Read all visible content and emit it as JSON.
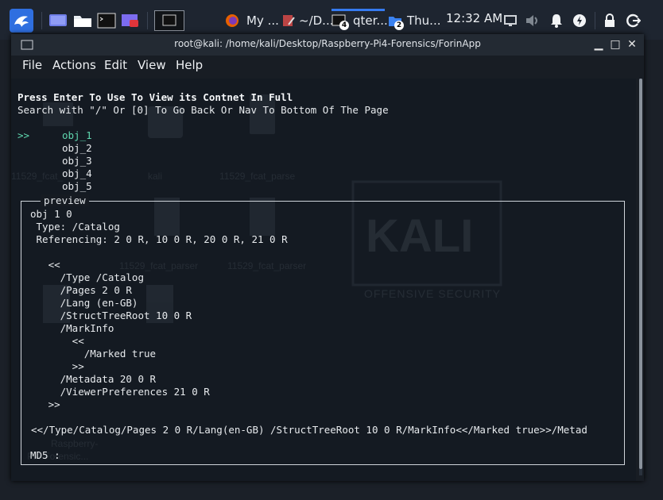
{
  "panel": {
    "tasks": [
      {
        "label": "My ...",
        "icon": "firefox-icon"
      },
      {
        "label": "~/D...",
        "icon": "text-editor-icon"
      },
      {
        "label": "qter...",
        "icon": "terminal-icon",
        "count": "4",
        "active": true
      },
      {
        "label": "Thu...",
        "icon": "folder-icon",
        "count": "2"
      }
    ],
    "clock": "12:32 AM"
  },
  "window": {
    "title": "root@kali: /home/kali/Desktop/Raspberry-Pi4-Forensics/ForinApp",
    "minimize": "▁",
    "maximize": "□",
    "close": "✕"
  },
  "menu": [
    "File",
    "Actions",
    "Edit",
    "View",
    "Help"
  ],
  "terminal": {
    "header1": "Press Enter To Use To View its Contnet In Full",
    "header2": "Search with \"/\" Or [0] To Go Back Or Nav To Bottom Of The Page",
    "cursor": ">>",
    "objects": [
      "obj_1",
      "obj_2",
      "obj_3",
      "obj_4",
      "obj_5"
    ],
    "preview_title": "preview",
    "preview_lines": [
      "obj 1 0",
      " Type: /Catalog",
      " Referencing: 2 0 R, 10 0 R, 20 0 R, 21 0 R",
      "",
      "   <<",
      "     /Type /Catalog",
      "     /Pages 2 0 R",
      "     /Lang (en-GB)",
      "     /StructTreeRoot 10 0 R",
      "     /MarkInfo",
      "       <<",
      "         /Marked true",
      "       >>",
      "     /Metadata 20 0 R",
      "     /ViewerPreferences 21 0 R",
      "   >>",
      "",
      "<</Type/Catalog/Pages 2 0 R/Lang(en-GB) /StructTreeRoot 10 0 R/MarkInfo<</Marked true>>/Metad",
      "",
      "MD5 :"
    ]
  },
  "desktop_bg": {
    "labels": [
      "11529_fcat_",
      "kali",
      "11529_fcat_parse",
      "11529_fcat_parser",
      "11529_fcat_parser",
      "Raspberry-",
      "Pi4-Forensic..."
    ],
    "kali_text": "KALI",
    "kali_sub": "OFFENSIVE SECURITY"
  },
  "colors": {
    "accent": "#367bf0",
    "selected": "#5fd7af",
    "text": "#e8ebee"
  }
}
